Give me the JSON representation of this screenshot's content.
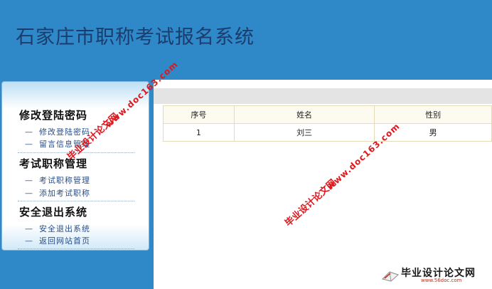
{
  "header": {
    "title": "石家庄市职称考试报名系统"
  },
  "sidebar": {
    "groups": [
      {
        "title": "修改登陆密码",
        "items": [
          "修改登陆密码",
          "留言信息管理"
        ]
      },
      {
        "title": "考试职称管理",
        "items": [
          "考试职称管理",
          "添加考试职称"
        ]
      },
      {
        "title": "安全退出系统",
        "items": [
          "安全退出系统",
          "返回网站首页"
        ]
      }
    ],
    "dash": "—"
  },
  "table": {
    "headers": [
      "序号",
      "姓名",
      "性别"
    ],
    "rows": [
      [
        "1",
        "刘三",
        "男"
      ]
    ]
  },
  "watermark": {
    "cn": "毕业设计论文网",
    "url": "www.doc163.com"
  },
  "logo": {
    "text": "毕业设计论文网",
    "url": "www.56doc.com"
  },
  "colors": {
    "header_bg": "#2f88c8",
    "title_text": "#1b3d6e",
    "watermark": "#e0161c"
  }
}
